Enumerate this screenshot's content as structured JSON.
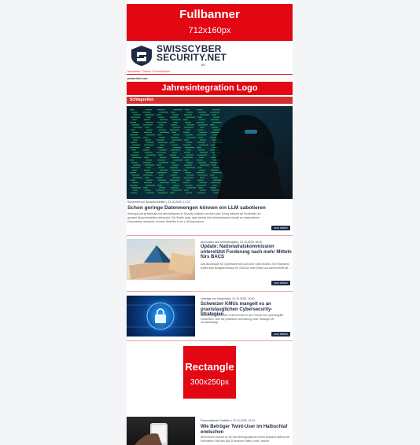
{
  "fullbanner": {
    "title": "Fullbanner",
    "size": "712x160px"
  },
  "logo": {
    "line1": "SWISSCYBER",
    "line2": "SECURITY.NET",
    "by": "BY"
  },
  "header_meta": "Newsletter / Datum / Kurzübersicht",
  "presented_by": "präsentiert von:",
  "jahres": {
    "title": "Jahresintegration Logo"
  },
  "section_label": "Schlagzeilen",
  "lead": {
    "meta": "Sicherheit von Sprachmodellen | 22.10.2025, 17:24",
    "headline": "Schon geringe Datenmengen können ein LLM sabotieren",
    "body": "Anthropic hat gemeinsam mit dem britischen AI Security Institute und dem Alan Turing Institute die Sicherheit von grossen Sprachmodellen untersucht. Die Studie zeigt, dass bereits eine überschaubare Anzahl an manipulierten Dokumenten ausreicht, um eine Hintertür in ein LLM einzubauen.",
    "button": "zum Artikel"
  },
  "articles": [
    {
      "meta": "Auf Kosten des Armeebudgets | 22.10.2025, 06:00",
      "headline": "Update: Nationalratskommission unterstützt Forderung nach mehr Mitteln fürs BACS",
      "body": "Das Bundesamt für Cybersicherheit soll mehr Geld erhalten. Der Ständerat fordert eine Budgeterhöhung für 2026 um zwei Drittel und damit betrifft die ...",
      "button": "zum Artikel"
    },
    {
      "meta": "Umfrage von Kaspersky | 21.10.2025, 14:00",
      "headline": "Schweizer KMUs mangelt es an praxistauglichen Cybersecurity-Strategien",
      "body": "Obwohl sich Schweizer Unternehmen in der Theorie auf Cyberangriffe vorbereiten, wird die praktische Umsetzung einer Strategie oft vernachlässigt.",
      "button": "zum Artikel"
    }
  ],
  "rectangle": {
    "title": "Rectangle",
    "size": "300x250px"
  },
  "article4": {
    "meta": "Personalisierte Gutfallen | 22.10.2025, 10:41",
    "headline": "Wie Betrüger Twint-User im Halbschlaf erwischen",
    "body": "Nicht immer braucht es für eine Betrugsmasche hohen Aufwand seitens der Kriminellen. Wie das BACS berichtet, fällen Leute, welche"
  },
  "colors": {
    "accent": "#e30613",
    "navy": "#1f2a44"
  }
}
